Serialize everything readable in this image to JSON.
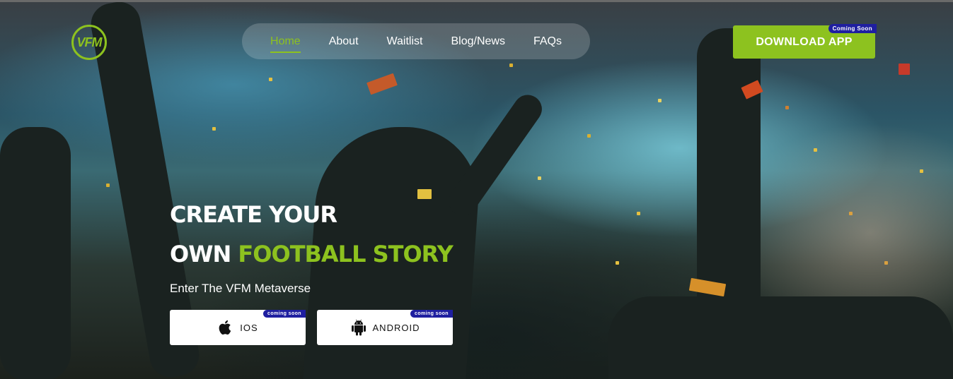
{
  "brand": {
    "logo_text": "VFM",
    "accent_color": "#8dc21f"
  },
  "nav": {
    "items": [
      {
        "label": "Home",
        "active": true
      },
      {
        "label": "About"
      },
      {
        "label": "Waitlist"
      },
      {
        "label": "Blog/News"
      },
      {
        "label": "FAQs"
      }
    ]
  },
  "header": {
    "download_label": "DOWNLOAD APP",
    "download_badge": "Coming Soon"
  },
  "hero": {
    "line1": "CREATE YOUR",
    "line2_start": "OWN",
    "line2_accent": "FOOTBALL STORY",
    "subtitle": "Enter The VFM Metaverse"
  },
  "stores": {
    "ios": {
      "label": "IOS",
      "badge": "coming soon",
      "icon": "apple-icon"
    },
    "android": {
      "label": "ANDROID",
      "badge": "coming soon",
      "icon": "android-icon"
    }
  }
}
